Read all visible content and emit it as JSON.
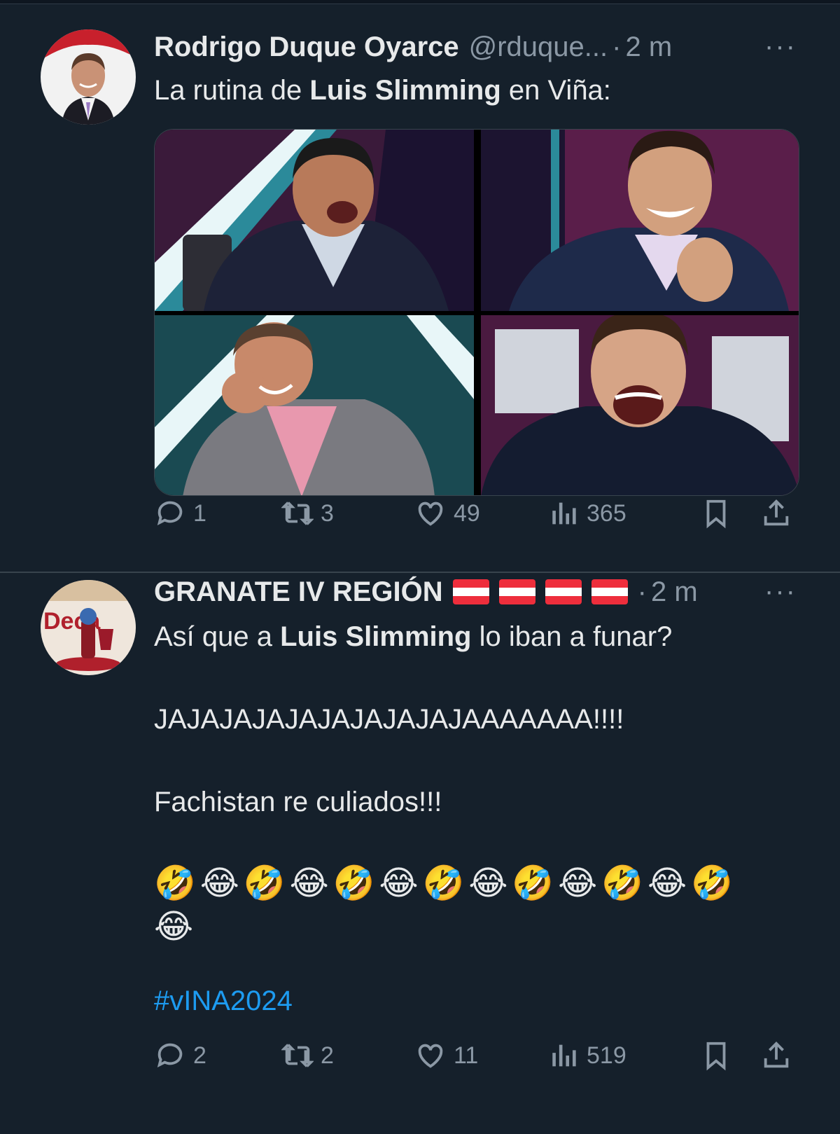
{
  "tweets": [
    {
      "name": "Rodrigo Duque Oyarce",
      "handle": "@rduque...",
      "separator": "·",
      "time": "2 m",
      "more": "···",
      "text_pre": "La rutina de ",
      "text_bold": "Luis Slimming",
      "text_post": " en Viña:",
      "media_description": [
        "laughing man in dark suit",
        "laughing man in suit clapping",
        "man laughing wiping eye",
        "man laughing with eyes closed"
      ],
      "actions": {
        "replies": "1",
        "retweets": "3",
        "likes": "49",
        "views": "365"
      }
    },
    {
      "name": "GRANATE IV REGIÓN",
      "flags": [
        "austria-flag",
        "austria-flag",
        "austria-flag",
        "austria-flag"
      ],
      "separator": "·",
      "time": "2 m",
      "more": "···",
      "text_pre": "Así que a ",
      "text_bold": "Luis Slimming",
      "text_post": " lo iban a funar?",
      "line2": "JAJAJAJAJAJAJAJAJAJAAAAAAA!!!!",
      "line3": "Fachistan re culiados!!!",
      "emojis_line1": "🤣😂🤣😂🤣😂🤣😂🤣😂🤣😂🤣",
      "emojis_line2": "😂",
      "hashtag": "#vINA2024",
      "actions": {
        "replies": "2",
        "retweets": "2",
        "likes": "11",
        "views": "519"
      }
    }
  ],
  "colors": {
    "background": "#15202b",
    "text": "#e7e9ea",
    "muted": "#8b98a5",
    "link": "#1d9bf0",
    "divider": "#38444d"
  }
}
